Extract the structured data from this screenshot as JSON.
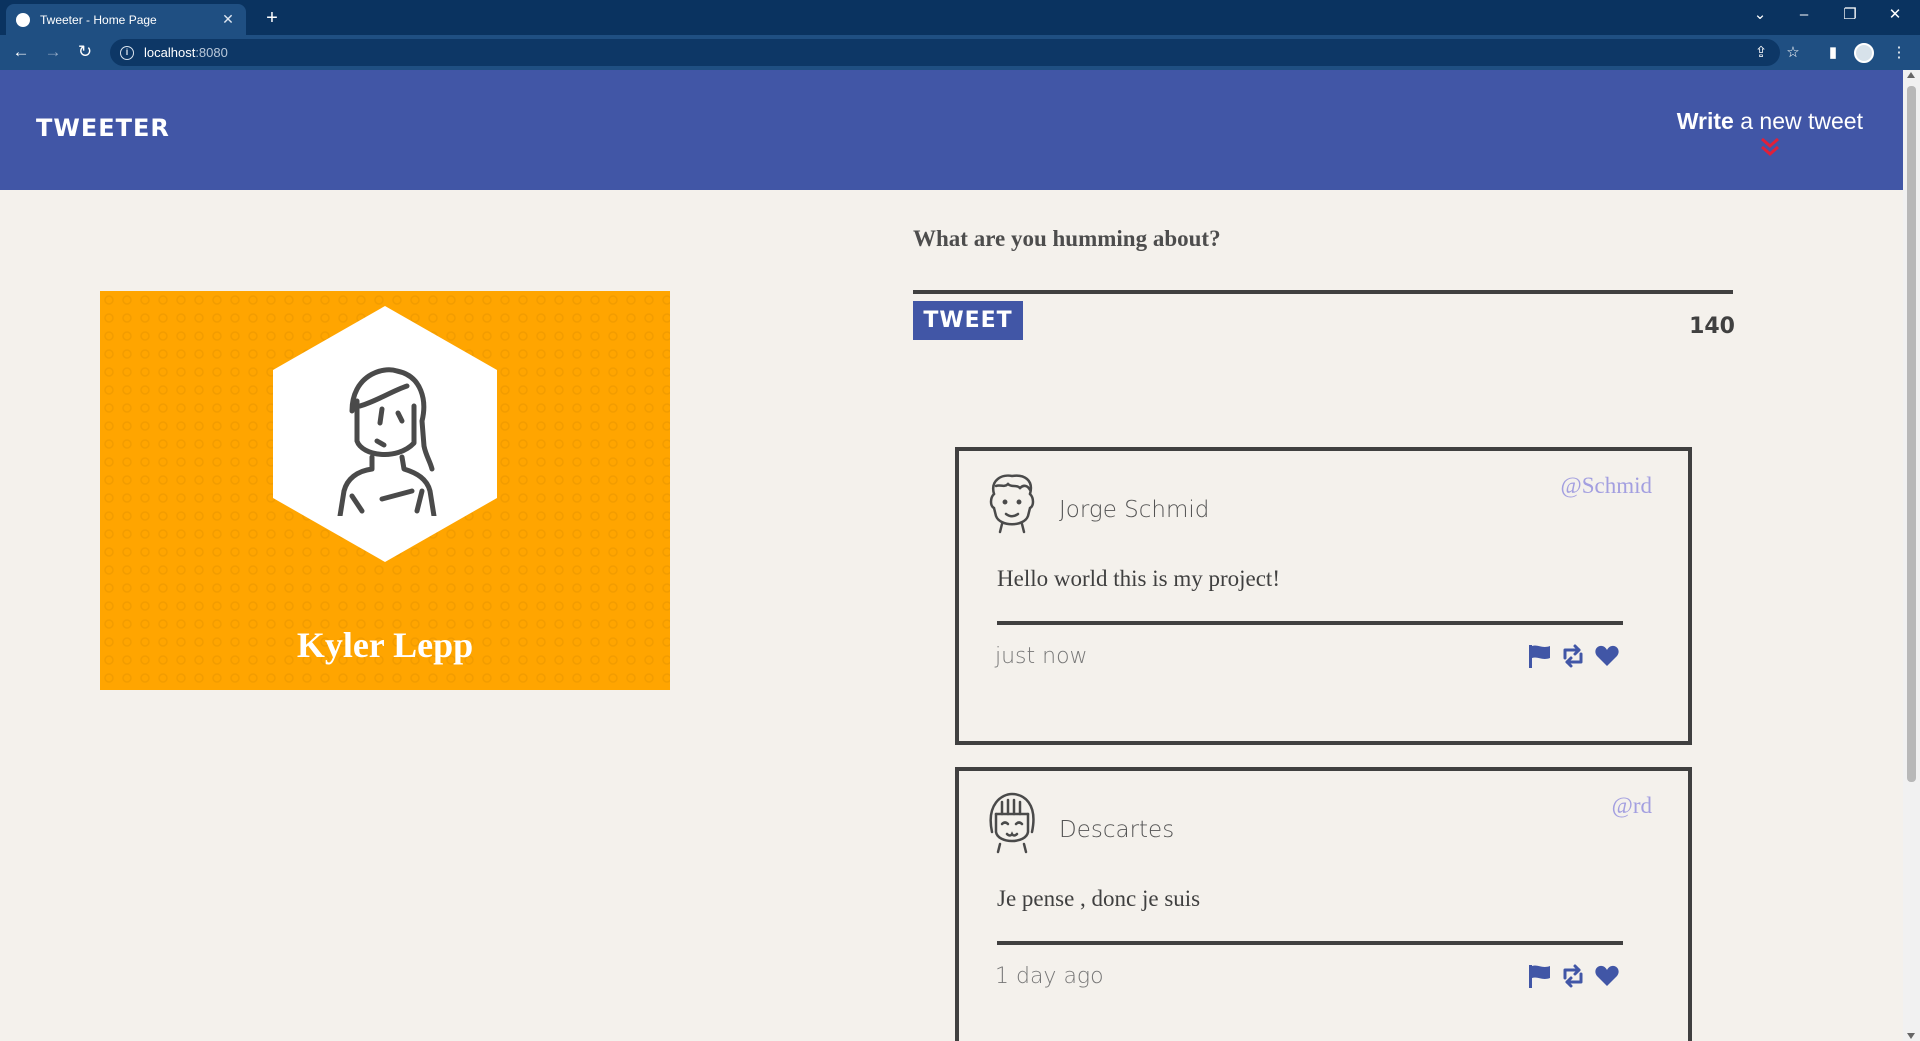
{
  "browser": {
    "tab_title": "Tweeter - Home Page",
    "tab_close": "✕",
    "new_tab": "+",
    "url_host": "localhost",
    "url_port": ":8080"
  },
  "nav": {
    "brand": "TWEETER",
    "compose_bold": "Write",
    "compose_rest": " a new tweet",
    "bg_color": "#4156a6",
    "chevron_color": "#e0203a"
  },
  "profile": {
    "name": "Kyler Lepp",
    "card_color": "#ffa500"
  },
  "compose": {
    "label": "What are you humming about?",
    "input_value": "",
    "button_label": "TWEET",
    "counter": "140"
  },
  "tweets": [
    {
      "author": "Jorge Schmid",
      "handle": "@Schmid",
      "content": "Hello world this is my project!",
      "timestamp": "just now",
      "avatar_icon": "man-avatar-icon"
    },
    {
      "author": "Descartes",
      "handle": "@rd",
      "content": "Je pense , donc je suis",
      "timestamp": "1 day ago",
      "avatar_icon": "woman-avatar-icon"
    }
  ],
  "icons": [
    "flag-icon",
    "retweet-icon",
    "heart-icon"
  ]
}
